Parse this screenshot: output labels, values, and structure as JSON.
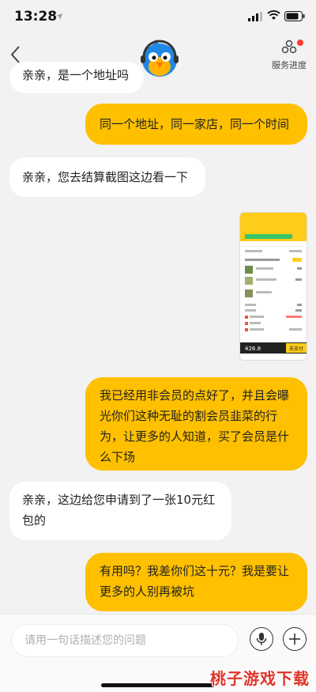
{
  "status": {
    "time": "13:28"
  },
  "header": {
    "service_label": "服务进度"
  },
  "messages": [
    {
      "side": "left",
      "text": "亲亲，是一个地址吗"
    },
    {
      "side": "right",
      "text": "同一个地址，同一家店，同一个时间"
    },
    {
      "side": "left",
      "text": "亲亲，您去结算截图这边看一下"
    },
    {
      "side": "right",
      "text": "我已经用非会员的点好了，并且会曝光你们这种无耻的割会员韭菜的行为，让更多的人知道，买了会员是什么下场"
    },
    {
      "side": "left",
      "text": "亲亲，这边给您申请到了一张10元红包的"
    },
    {
      "side": "right",
      "text": "有用吗？我差你们这十元？我是要让更多的人别再被坑"
    }
  ],
  "screenshot": {
    "price": "¥26.8",
    "pay_label": "去支付"
  },
  "input": {
    "placeholder": "请用一句话描述您的问题"
  },
  "watermark": "桃子游戏下载"
}
